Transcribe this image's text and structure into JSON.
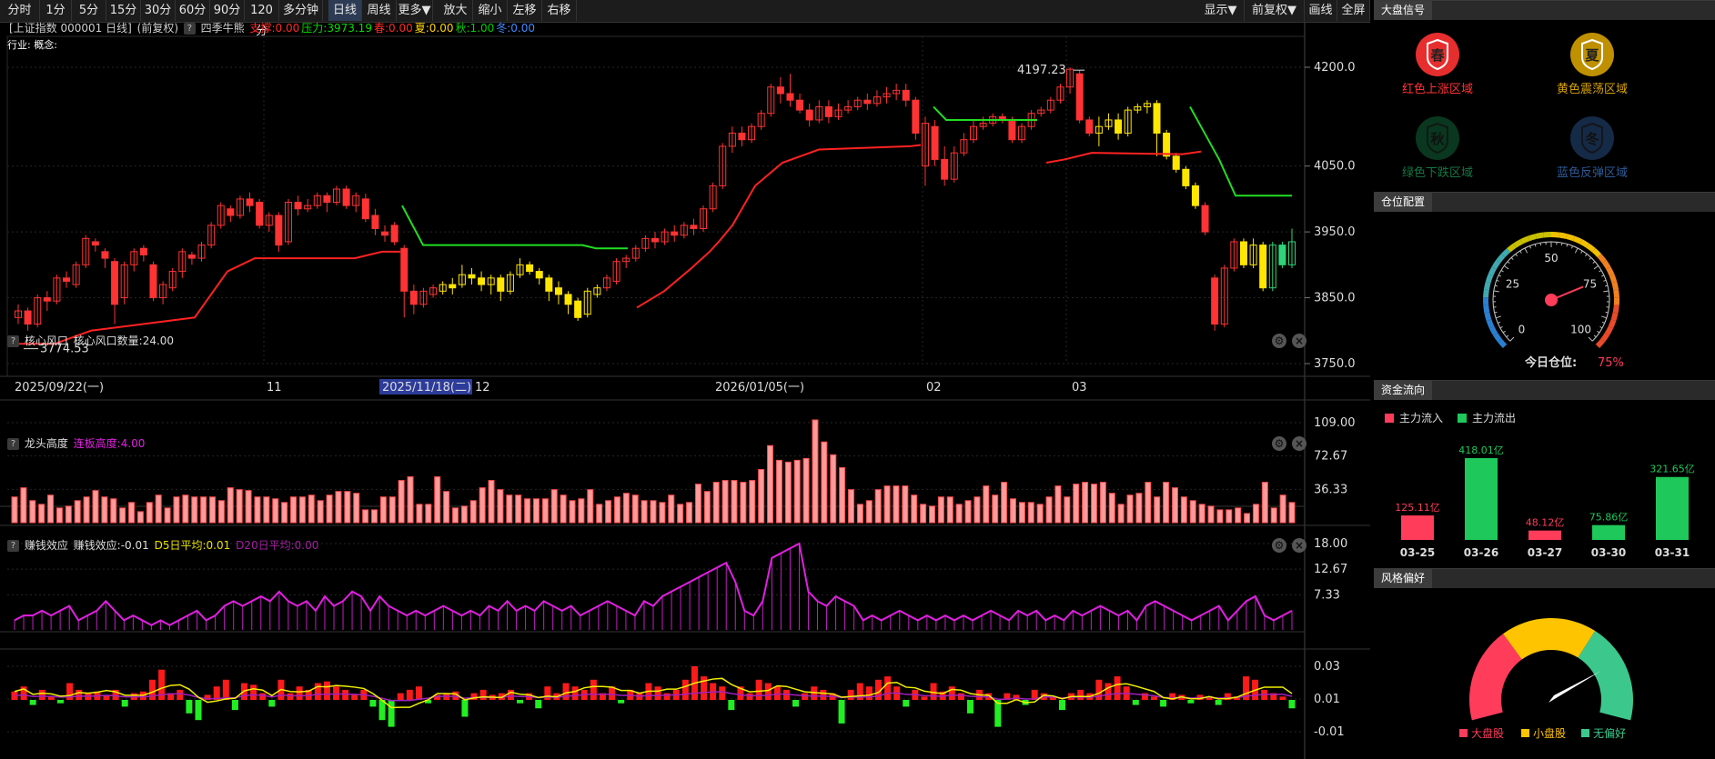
{
  "toolbar": {
    "left_buttons": [
      "分时",
      "1分",
      "5分",
      "15分",
      "30分",
      "60分",
      "90分",
      "120分",
      "多分钟",
      "日线",
      "周线",
      "更多▼",
      "放大",
      "缩小",
      "左移",
      "右移"
    ],
    "active": "日线",
    "right_buttons": [
      "显示▼",
      "前复权▼",
      "画线",
      "全屏"
    ]
  },
  "main_header": {
    "title": "[上证指数 000001 日线]",
    "adjust": "(前复权)",
    "indicator": "四季牛熊",
    "values": [
      {
        "text": "支撑:0.00",
        "color": "#ff2a2a"
      },
      {
        "text": "压力:3973.19",
        "color": "#00e000"
      },
      {
        "text": "春:0.00",
        "color": "#ff2a2a"
      },
      {
        "text": "夏:0.00",
        "color": "#ffd400"
      },
      {
        "text": "秋:1.00",
        "color": "#00d000"
      },
      {
        "text": "冬:0.00",
        "color": "#3c8cff"
      }
    ],
    "industry_label": "行业: 概念:"
  },
  "main_chart": {
    "y_ticks": [
      "4200.0",
      "4050.0",
      "3950.0",
      "3850.0",
      "3750.0"
    ],
    "date_labels": [
      {
        "text": "2025/09/22(一)",
        "highlight": false
      },
      {
        "text": "11",
        "highlight": false
      },
      {
        "text": "2025/11/18(二)",
        "highlight": true
      },
      {
        "text": "12",
        "highlight": false
      },
      {
        "text": "2026/01/05(一)",
        "highlight": false
      },
      {
        "text": "02",
        "highlight": false
      },
      {
        "text": "03",
        "highlight": false
      }
    ],
    "max_label": "4197.23",
    "min_label": "3774.53"
  },
  "panel1": {
    "name": "核心风口",
    "value_text": "核心风口数量:24.00",
    "y_ticks": [
      "109.00",
      "72.67",
      "36.33"
    ]
  },
  "panel2": {
    "name": "龙头高度",
    "value_text": "连板高度:4.00",
    "y_ticks": [
      "18.00",
      "12.67",
      "7.33"
    ]
  },
  "panel3": {
    "name": "赚钱效应",
    "value_text": "赚钱效应:-0.01",
    "d5_text": "D5日平均:0.01",
    "d20_text": "D20日平均:0.00",
    "y_ticks": [
      "0.03",
      "0.01",
      "-0.01"
    ]
  },
  "right_panel": {
    "signal": {
      "title": "大盘信号",
      "items": [
        {
          "label": "红色上涨区域",
          "char": "春",
          "color": "#ff3333"
        },
        {
          "label": "黄色震荡区域",
          "char": "夏",
          "color": "#d4a000"
        },
        {
          "label": "绿色下跌区域",
          "char": "秋",
          "color": "#1e9e5a"
        },
        {
          "label": "蓝色反弹区域",
          "char": "冬",
          "color": "#3c78c8"
        }
      ]
    },
    "position": {
      "title": "仓位配置",
      "gauge_ticks": [
        "0",
        "25",
        "50",
        "75",
        "100"
      ],
      "gauge_value": 75,
      "today_label": "今日仓位:",
      "today_value": "75%"
    },
    "capital": {
      "title": "资金流向",
      "legend_in": "主力流入",
      "legend_out": "主力流出",
      "bars": [
        {
          "date": "03-25",
          "label": "125.11亿",
          "value": 125.11,
          "direction": "in"
        },
        {
          "date": "03-26",
          "label": "418.01亿",
          "value": 418.01,
          "direction": "out"
        },
        {
          "date": "03-27",
          "label": "48.12亿",
          "value": 48.12,
          "direction": "in"
        },
        {
          "date": "03-30",
          "label": "75.86亿",
          "value": 75.86,
          "direction": "out"
        },
        {
          "date": "03-31",
          "label": "321.65亿",
          "value": 321.65,
          "direction": "out"
        }
      ]
    },
    "style": {
      "title": "风格偏好",
      "legend": [
        {
          "label": "大盘股",
          "color": "#ff3c5a"
        },
        {
          "label": "小盘股",
          "color": "#ffc400"
        },
        {
          "label": "无偏好",
          "color": "#3cc88c"
        }
      ]
    }
  },
  "chart_data": [
    {
      "type": "candlestick",
      "title": "上证指数 000001 日线",
      "x_start": "2025/09/22",
      "x_end": "2026/03/31",
      "ylim": [
        3750,
        4210
      ],
      "candles": [
        [
          3820,
          3830,
          3810,
          3840
        ],
        [
          3830,
          3810,
          3800,
          3835
        ],
        [
          3810,
          3850,
          3805,
          3855
        ],
        [
          3850,
          3845,
          3830,
          3860
        ],
        [
          3845,
          3880,
          3840,
          3885
        ],
        [
          3880,
          3875,
          3865,
          3890
        ],
        [
          3870,
          3900,
          3865,
          3905
        ],
        [
          3900,
          3940,
          3895,
          3945
        ],
        [
          3935,
          3930,
          3920,
          3940
        ],
        [
          3920,
          3910,
          3895,
          3925
        ],
        [
          3905,
          3840,
          3810,
          3910
        ],
        [
          3850,
          3900,
          3840,
          3905
        ],
        [
          3900,
          3920,
          3890,
          3925
        ],
        [
          3925,
          3915,
          3905,
          3930
        ],
        [
          3900,
          3850,
          3845,
          3905
        ],
        [
          3850,
          3870,
          3840,
          3875
        ],
        [
          3865,
          3890,
          3860,
          3895
        ],
        [
          3890,
          3920,
          3880,
          3925
        ],
        [
          3915,
          3910,
          3900,
          3920
        ],
        [
          3910,
          3930,
          3905,
          3935
        ],
        [
          3930,
          3960,
          3925,
          3965
        ],
        [
          3960,
          3990,
          3955,
          3995
        ],
        [
          3985,
          3975,
          3965,
          3990
        ],
        [
          3975,
          4000,
          3970,
          4005
        ],
        [
          4000,
          3990,
          3980,
          4010
        ],
        [
          3995,
          3960,
          3955,
          4000
        ],
        [
          3960,
          3975,
          3950,
          3980
        ],
        [
          3975,
          3930,
          3920,
          3980
        ],
        [
          3935,
          3995,
          3930,
          4000
        ],
        [
          3995,
          3985,
          3975,
          4005
        ],
        [
          3985,
          3990,
          3980,
          4000
        ],
        [
          3990,
          4005,
          3985,
          4010
        ],
        [
          4005,
          3995,
          3980,
          4010
        ],
        [
          3995,
          4015,
          3990,
          4020
        ],
        [
          4015,
          3990,
          3985,
          4020
        ],
        [
          3990,
          4005,
          3980,
          4010
        ],
        [
          4000,
          3970,
          3965,
          4008
        ],
        [
          3975,
          3955,
          3945,
          3985
        ],
        [
          3950,
          3945,
          3935,
          3960
        ],
        [
          3960,
          3935,
          3930,
          3965
        ],
        [
          3925,
          3860,
          3820,
          3930
        ],
        [
          3860,
          3840,
          3825,
          3870
        ],
        [
          3840,
          3860,
          3835,
          3865
        ],
        [
          3855,
          3865,
          3850,
          3870
        ],
        [
          3860,
          3870,
          3855,
          3875
        ],
        [
          3870,
          3865,
          3855,
          3880
        ],
        [
          3870,
          3885,
          3865,
          3900
        ],
        [
          3885,
          3880,
          3870,
          3895
        ],
        [
          3880,
          3870,
          3860,
          3890
        ],
        [
          3870,
          3880,
          3855,
          3885
        ],
        [
          3880,
          3860,
          3845,
          3885
        ],
        [
          3860,
          3885,
          3855,
          3890
        ],
        [
          3885,
          3900,
          3880,
          3910
        ],
        [
          3900,
          3890,
          3885,
          3905
        ],
        [
          3890,
          3880,
          3870,
          3895
        ],
        [
          3880,
          3860,
          3845,
          3885
        ],
        [
          3865,
          3855,
          3840,
          3875
        ],
        [
          3855,
          3840,
          3825,
          3860
        ],
        [
          3845,
          3820,
          3815,
          3850
        ],
        [
          3825,
          3860,
          3820,
          3865
        ],
        [
          3855,
          3865,
          3850,
          3870
        ],
        [
          3865,
          3880,
          3860,
          3885
        ],
        [
          3875,
          3905,
          3870,
          3910
        ],
        [
          3905,
          3910,
          3895,
          3915
        ],
        [
          3910,
          3925,
          3905,
          3930
        ],
        [
          3925,
          3940,
          3920,
          3945
        ],
        [
          3940,
          3935,
          3925,
          3950
        ],
        [
          3935,
          3950,
          3930,
          3955
        ],
        [
          3950,
          3945,
          3935,
          3960
        ],
        [
          3945,
          3960,
          3940,
          3965
        ],
        [
          3960,
          3955,
          3945,
          3970
        ],
        [
          3955,
          3985,
          3950,
          3990
        ],
        [
          3985,
          4020,
          3980,
          4025
        ],
        [
          4020,
          4080,
          4015,
          4085
        ],
        [
          4080,
          4100,
          4070,
          4110
        ],
        [
          4100,
          4090,
          4080,
          4110
        ],
        [
          4090,
          4110,
          4085,
          4115
        ],
        [
          4110,
          4130,
          4105,
          4135
        ],
        [
          4130,
          4170,
          4125,
          4175
        ],
        [
          4170,
          4160,
          4145,
          4185
        ],
        [
          4160,
          4150,
          4140,
          4190
        ],
        [
          4150,
          4135,
          4130,
          4160
        ],
        [
          4135,
          4120,
          4110,
          4145
        ],
        [
          4120,
          4140,
          4115,
          4150
        ],
        [
          4140,
          4125,
          4115,
          4150
        ],
        [
          4125,
          4135,
          4120,
          4145
        ],
        [
          4135,
          4140,
          4130,
          4150
        ],
        [
          4140,
          4150,
          4135,
          4155
        ],
        [
          4150,
          4145,
          4135,
          4160
        ],
        [
          4145,
          4155,
          4140,
          4165
        ],
        [
          4155,
          4160,
          4145,
          4170
        ],
        [
          4160,
          4165,
          4150,
          4175
        ],
        [
          4165,
          4150,
          4140,
          4175
        ],
        [
          4150,
          4100,
          4090,
          4155
        ],
        [
          4050,
          4115,
          4020,
          4125
        ],
        [
          4110,
          4060,
          4050,
          4120
        ],
        [
          4060,
          4030,
          4020,
          4080
        ],
        [
          4030,
          4070,
          4025,
          4080
        ],
        [
          4070,
          4090,
          4065,
          4100
        ],
        [
          4090,
          4110,
          4085,
          4120
        ],
        [
          4110,
          4115,
          4105,
          4125
        ],
        [
          4115,
          4125,
          4110,
          4130
        ],
        [
          4125,
          4120,
          4115,
          4130
        ],
        [
          4120,
          4090,
          4085,
          4125
        ],
        [
          4090,
          4110,
          4085,
          4115
        ],
        [
          4110,
          4130,
          4105,
          4135
        ],
        [
          4130,
          4135,
          4125,
          4140
        ],
        [
          4135,
          4150,
          4130,
          4155
        ],
        [
          4150,
          4170,
          4145,
          4175
        ],
        [
          4170,
          4197,
          4160,
          4200
        ],
        [
          4190,
          4120,
          4115,
          4195
        ],
        [
          4120,
          4100,
          4095,
          4125
        ],
        [
          4100,
          4110,
          4080,
          4125
        ],
        [
          4110,
          4120,
          4105,
          4130
        ],
        [
          4120,
          4100,
          4090,
          4130
        ],
        [
          4100,
          4135,
          4095,
          4140
        ],
        [
          4135,
          4140,
          4130,
          4145
        ],
        [
          4140,
          4145,
          4130,
          4150
        ],
        [
          4145,
          4100,
          4065,
          4150
        ],
        [
          4100,
          4065,
          4060,
          4105
        ],
        [
          4065,
          4045,
          4040,
          4070
        ],
        [
          4045,
          4020,
          4015,
          4050
        ],
        [
          4020,
          3990,
          3985,
          4025
        ],
        [
          3990,
          3950,
          3945,
          3995
        ],
        [
          3880,
          3810,
          3800,
          3885
        ],
        [
          3810,
          3895,
          3805,
          3900
        ],
        [
          3895,
          3935,
          3890,
          3940
        ],
        [
          3935,
          3900,
          3895,
          3940
        ],
        [
          3900,
          3930,
          3895,
          3940
        ],
        [
          3930,
          3865,
          3860,
          3935
        ],
        [
          3865,
          3930,
          3860,
          3935
        ],
        [
          3930,
          3900,
          3895,
          3935
        ],
        [
          3900,
          3935,
          3895,
          3955
        ]
      ],
      "support_line": [
        [
          3779,
          10,
          50
        ],
        [
          3779,
          10,
          50
        ],
        [
          3779,
          10,
          50
        ],
        [
          3779,
          10,
          50
        ],
        [
          3779,
          10,
          50
        ],
        [
          3779,
          10,
          50
        ],
        [
          3779,
          10,
          50
        ],
        [
          3779,
          10,
          50
        ],
        [
          3779,
          10,
          50
        ],
        [
          3779,
          10,
          50
        ],
        [
          3820,
          10,
          50
        ],
        [
          3830,
          10,
          50
        ],
        [
          3830,
          10,
          50
        ],
        [
          3830,
          10,
          50
        ],
        [
          3830,
          10,
          50
        ],
        [
          3830,
          10,
          50
        ],
        [
          3830,
          10,
          50
        ],
        [
          3830,
          10,
          50
        ],
        [
          3830,
          10,
          50
        ],
        [
          3830,
          10,
          50
        ],
        [
          3860,
          10,
          50
        ],
        [
          3900,
          10,
          50
        ],
        [
          3910,
          10,
          50
        ],
        [
          3910,
          10,
          50
        ],
        [
          3910,
          10,
          50
        ],
        [
          3910,
          10,
          50
        ],
        [
          3910,
          10,
          50
        ],
        [
          3910,
          10,
          50
        ],
        [
          3910,
          10,
          50
        ],
        [
          3910,
          10,
          50
        ],
        [
          3910,
          10,
          50
        ],
        [
          3910,
          10,
          50
        ],
        [
          3910,
          10,
          50
        ],
        [
          3920,
          10,
          50
        ],
        [
          3920,
          10,
          50
        ],
        [
          3920,
          10,
          50
        ],
        [
          3920,
          10,
          50
        ],
        [
          3920,
          10,
          50
        ],
        [
          3920,
          10,
          50
        ],
        [
          3920,
          10,
          50
        ]
      ],
      "note": "support/resistance traced as polylines"
    }
  ]
}
